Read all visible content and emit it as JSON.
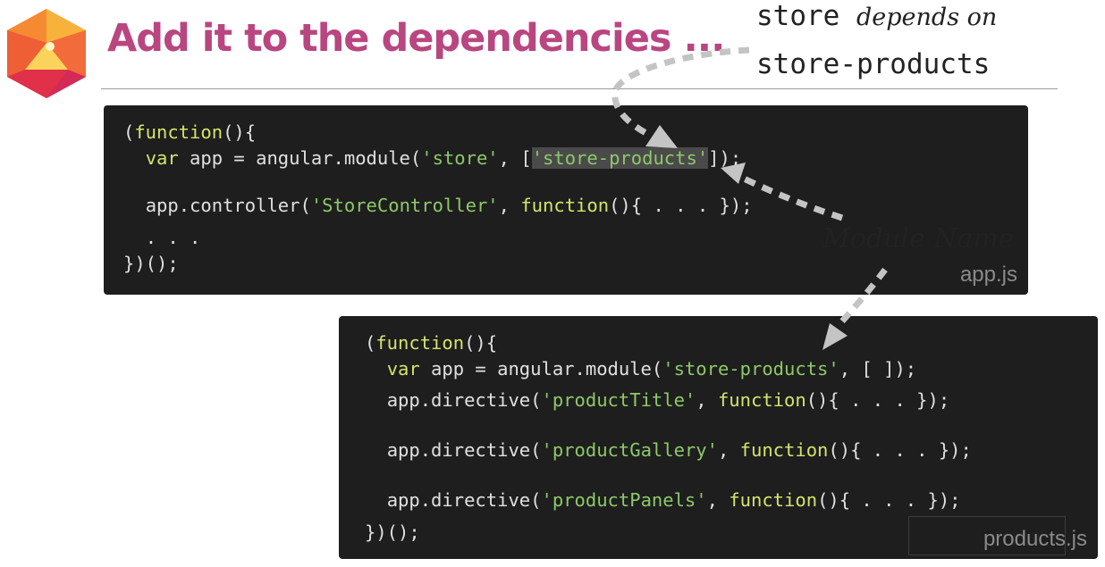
{
  "slide": {
    "title": "Add it to the dependencies ..."
  },
  "note": {
    "line1_code": "store",
    "line1_hand": "depends on",
    "line2_code": "store-products"
  },
  "module_label": "Module Name",
  "app_file": {
    "label": "app.js",
    "l1_open": "(",
    "l1_kw": "function",
    "l1_rest": "(){",
    "l2_kw": "var",
    "l2_mid": " app = angular.module(",
    "l2_str": "'store'",
    "l2_sep": ", [",
    "l2_dep": "'store-products'",
    "l2_end": "]);",
    "l3_pre": "app.controller(",
    "l3_str": "'StoreController'",
    "l3_sep": ", ",
    "l3_kw": "function",
    "l3_end": "(){ . . . });",
    "l4": ". . .",
    "l5": "})();"
  },
  "products_file": {
    "label": "products.js",
    "l1_open": "(",
    "l1_kw": "function",
    "l1_rest": "(){",
    "l2_kw": "var",
    "l2_mid": " app = angular.module(",
    "l2_str": "'store-products'",
    "l2_end": ", [ ]);",
    "l3_pre": "app.directive(",
    "l3_str": "'productTitle'",
    "l3_sep": ", ",
    "l3_kw": "function",
    "l3_end": "(){ . . . });",
    "l4_pre": "app.directive(",
    "l4_str": "'productGallery'",
    "l4_sep": ", ",
    "l4_kw": "function",
    "l4_end": "(){ . . . });",
    "l5_pre": "app.directive(",
    "l5_str": "'productPanels'",
    "l5_sep": ", ",
    "l5_kw": "function",
    "l5_end": "(){ . . . });",
    "l6": "})();"
  },
  "colors": {
    "title": "#b94680",
    "code_bg": "#1e1e1e",
    "keyword": "#d5e36c",
    "string": "#8dc968",
    "file_label": "#8a8a8a"
  },
  "icons": {
    "logo": "faceted-gem-logo"
  }
}
